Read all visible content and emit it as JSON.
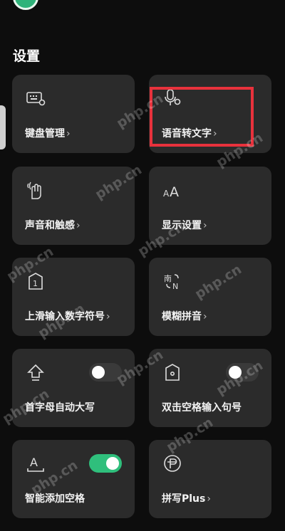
{
  "section_title": "设置",
  "watermark": "php.cn",
  "colors": {
    "background": "#0d0d0d",
    "card": "#2b2b2b",
    "toggle_on": "#2fbf7c",
    "highlight_box": "#e8323c"
  },
  "cards": [
    {
      "label": "键盘管理",
      "icon": "keyboard-settings-icon",
      "chevron": "›"
    },
    {
      "label": "语音转文字",
      "icon": "microphone-settings-icon",
      "chevron": "›"
    },
    {
      "label": "声音和触感",
      "icon": "hand-vibration-icon",
      "chevron": "›"
    },
    {
      "label": "显示设置",
      "icon": "font-size-icon",
      "chevron": "›"
    },
    {
      "label": "上滑输入数字符号",
      "icon": "swipe-number-icon",
      "chevron": "›"
    },
    {
      "label": "模糊拼音",
      "icon": "fuzzy-pinyin-icon",
      "chevron": "›"
    },
    {
      "label": "首字母自动大写",
      "icon": "auto-capitalize-icon",
      "toggle": "off"
    },
    {
      "label": "双击空格输入句号",
      "icon": "double-space-period-icon",
      "toggle": "off"
    },
    {
      "label": "智能添加空格",
      "icon": "smart-space-icon",
      "toggle": "on"
    },
    {
      "label": "拼写Plus",
      "icon": "spell-plus-icon",
      "chevron": "›"
    }
  ]
}
